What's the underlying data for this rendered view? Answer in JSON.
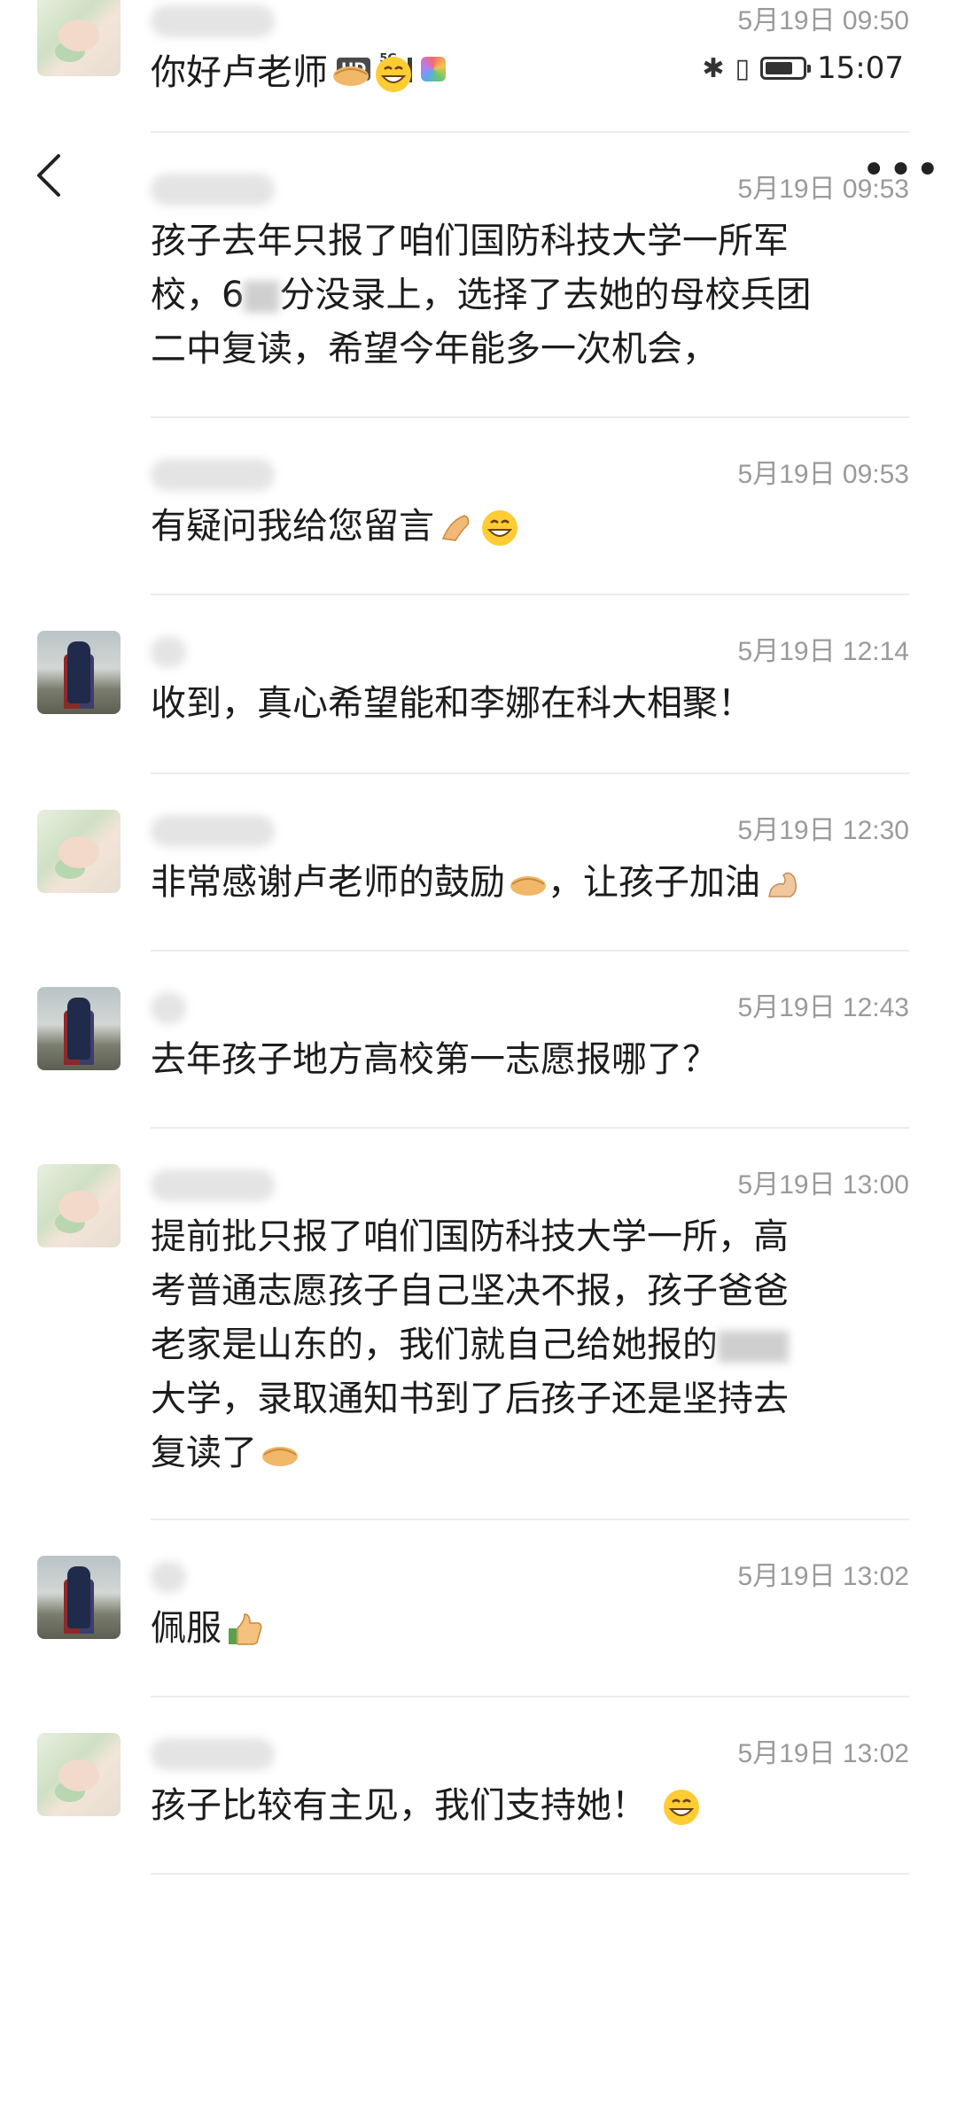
{
  "status_bar": {
    "hd": "HD",
    "network": "5G",
    "time": "15:07"
  },
  "nav": {
    "back_icon": "chevron-left-icon",
    "more_icon": "more-horizontal-icon"
  },
  "messages": [
    {
      "time": "5月19日 09:50",
      "text": "你好卢老师"
    },
    {
      "time": "5月19日 09:53",
      "line1": "孩子去年只报了咱们国防科技大学一所军",
      "line2_a": "校，6",
      "line2_b": "分没录上，选择了去她的母校兵团",
      "line3": "二中复读，希望今年能多一次机会，"
    },
    {
      "time": "5月19日 09:53",
      "text": "有疑问我给您留言"
    },
    {
      "time": "5月19日 12:14",
      "text": "收到，真心希望能和李娜在科大相聚！"
    },
    {
      "time": "5月19日 12:30",
      "text_a": "非常感谢卢老师的鼓励",
      "text_b": "，让孩子加油"
    },
    {
      "time": "5月19日 12:43",
      "text": "去年孩子地方高校第一志愿报哪了？"
    },
    {
      "time": "5月19日 13:00",
      "line1": "提前批只报了咱们国防科技大学一所，高",
      "line2": "考普通志愿孩子自己坚决不报，孩子爸爸",
      "line3": "老家是山东的，我们就自己给她报的",
      "line4": "大学，录取通知书到了后孩子还是坚持去",
      "line5": "复读了"
    },
    {
      "time": "5月19日 13:02",
      "text": "佩服"
    },
    {
      "time": "5月19日 13:02",
      "text": "孩子比较有主见，我们支持她！"
    }
  ],
  "colors": {
    "background": "#ffffff",
    "time": "#9a9a9a",
    "divider": "#ececec"
  }
}
